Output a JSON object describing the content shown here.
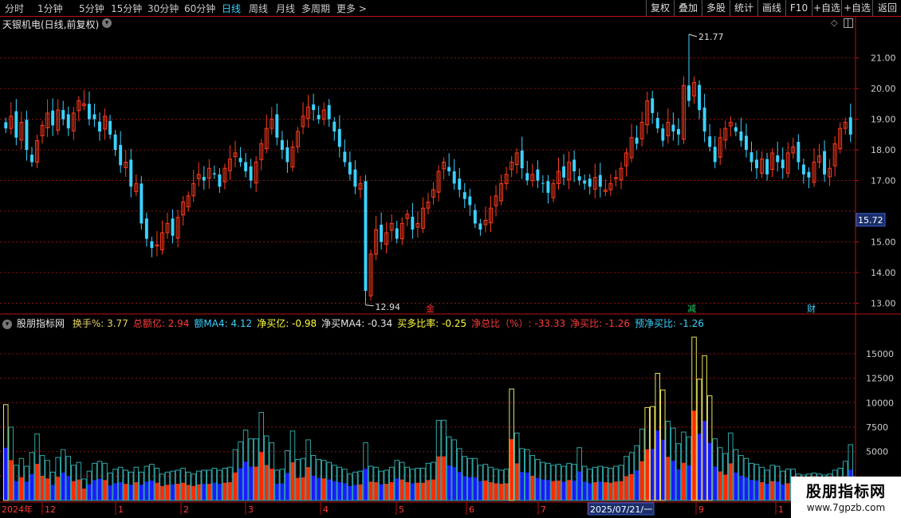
{
  "toolbar": {
    "periods": [
      {
        "label": "分时",
        "active": false
      },
      {
        "label": "1分钟",
        "active": false
      },
      {
        "label": "5分钟",
        "active": false
      },
      {
        "label": "15分钟",
        "active": false
      },
      {
        "label": "30分钟",
        "active": false
      },
      {
        "label": "60分钟",
        "active": false
      },
      {
        "label": "日线",
        "active": true
      },
      {
        "label": "周线",
        "active": false
      },
      {
        "label": "月线",
        "active": false
      },
      {
        "label": "多周期",
        "active": false
      },
      {
        "label": "更多 >",
        "active": false
      }
    ],
    "actions": [
      "复权",
      "叠加",
      "多股",
      "统计",
      "画线",
      "F10",
      "+自选",
      "返回"
    ],
    "periods_wide": [
      0,
      0,
      0,
      0,
      0,
      0,
      0,
      0,
      0,
      0,
      0
    ]
  },
  "price_panel": {
    "title": "天银机电(日线,前复权)",
    "y_ticks": [
      "21.00",
      "20.00",
      "19.00",
      "18.00",
      "17.00",
      "15.00",
      "14.00",
      "13.00"
    ],
    "current_price": "15.72",
    "high_label": "21.77",
    "low_label": "12.94",
    "markers": [
      {
        "text": "金",
        "color": "#ff3030"
      },
      {
        "text": "减",
        "color": "#22cc66"
      },
      {
        "text": "财",
        "color": "#3bd2ff"
      }
    ]
  },
  "indicator": {
    "name": "股朋指标网",
    "items": [
      {
        "label": "换手%: 3.77",
        "color": "#e8d26a"
      },
      {
        "label": "总额亿: 2.94",
        "color": "#ff3b3b"
      },
      {
        "label": "额MA4: 4.12",
        "color": "#3bd2ff"
      },
      {
        "label": "净买亿: -0.98",
        "color": "#ffff3b"
      },
      {
        "label": "净买MA4: -0.34",
        "color": "#e6e6e6"
      },
      {
        "label": "买多比率: -0.25",
        "color": "#ffff3b"
      },
      {
        "label": "净总比（%）: -33.33",
        "color": "#ff3b3b"
      },
      {
        "label": "净买比: -1.26",
        "color": "#ff3b3b"
      },
      {
        "label": "预净买比: -1.26",
        "color": "#3bd2ff"
      }
    ],
    "y_ticks": [
      "15000",
      "12500",
      "10000",
      "7500",
      "5000"
    ]
  },
  "date_axis": [
    "2024年",
    "12",
    "1",
    "2",
    "3",
    "4",
    "5",
    "6",
    "7",
    "2025/07/21/一",
    "9",
    "1"
  ],
  "watermark": {
    "title": "股朋指标网",
    "url": "www.7gpzb.com"
  },
  "colors": {
    "up": "#ff3b1e",
    "down": "#3bd2ff",
    "grid": "#8b1414",
    "vol_up": "#ff2a00",
    "vol_down": "#1a1aff",
    "ma_outline": "#2fa7a7",
    "peak_outline": "#e8e15a"
  },
  "chart_data": {
    "type": "candlestick",
    "y_range": [
      12.7,
      21.9
    ],
    "high": 21.77,
    "low": 12.94,
    "last": 15.72,
    "x_labels": [
      "2024年",
      "12",
      "1",
      "2",
      "3",
      "4",
      "5",
      "6",
      "7",
      "2025/07/21/一",
      "9",
      "1"
    ],
    "close": [
      18.7,
      19.1,
      18.4,
      18.9,
      18.0,
      17.6,
      18.3,
      18.8,
      19.2,
      18.8,
      19.3,
      19.0,
      18.7,
      19.2,
      19.6,
      19.5,
      19.0,
      19.0,
      18.6,
      19.1,
      18.5,
      18.0,
      17.5,
      17.6,
      16.8,
      16.9,
      15.6,
      15.1,
      14.8,
      14.9,
      15.3,
      15.6,
      15.2,
      15.8,
      16.3,
      16.5,
      16.9,
      17.2,
      17.0,
      17.4,
      17.2,
      16.8,
      17.4,
      17.7,
      17.9,
      17.6,
      17.3,
      17.0,
      17.6,
      18.2,
      18.7,
      19.0,
      18.4,
      18.0,
      17.6,
      18.1,
      18.6,
      19.1,
      19.4,
      19.3,
      19.0,
      19.3,
      19.0,
      18.6,
      18.1,
      17.6,
      17.2,
      16.8,
      16.9,
      13.4,
      14.6,
      15.4,
      15.0,
      15.3,
      15.6,
      15.1,
      15.6,
      15.9,
      15.4,
      15.6,
      16.1,
      16.3,
      16.7,
      17.3,
      17.6,
      17.3,
      16.9,
      16.7,
      16.4,
      16.2,
      15.6,
      15.4,
      15.7,
      16.1,
      16.5,
      16.9,
      17.2,
      17.6,
      17.9,
      17.4,
      17.0,
      17.2,
      17.0,
      16.9,
      16.6,
      16.9,
      17.3,
      17.1,
      17.6,
      17.3,
      17.0,
      16.9,
      16.8,
      17.1,
      16.8,
      16.7,
      16.9,
      17.1,
      17.4,
      17.9,
      18.4,
      18.2,
      18.9,
      19.6,
      19.2,
      18.7,
      18.3,
      18.9,
      18.6,
      18.5,
      20.1,
      19.6,
      20.2,
      19.3,
      18.6,
      18.1,
      17.6,
      18.4,
      18.7,
      18.9,
      18.6,
      18.3,
      18.0,
      17.6,
      17.4,
      17.7,
      17.2,
      17.9,
      17.6,
      17.4,
      17.9,
      18.1,
      17.6,
      17.2,
      17.1,
      17.6,
      17.8,
      17.2,
      17.4,
      18.2,
      18.7,
      18.9,
      18.5
    ],
    "volume": [
      9800,
      7500,
      3600,
      4300,
      3500,
      4900,
      6800,
      4600,
      4100,
      2900,
      4400,
      5200,
      4500,
      3600,
      3900,
      2200,
      3000,
      3800,
      4000,
      3800,
      2800,
      3200,
      3400,
      3100,
      2900,
      3400,
      2900,
      3500,
      3700,
      3300,
      2700,
      2900,
      3000,
      3100,
      3300,
      2900,
      2700,
      3000,
      3100,
      3100,
      3300,
      3100,
      3300,
      3400,
      5200,
      6000,
      7200,
      6300,
      6300,
      9000,
      6600,
      5900,
      3100,
      3200,
      5100,
      7100,
      4200,
      4300,
      6200,
      4600,
      4200,
      4100,
      3900,
      3600,
      3400,
      3200,
      2700,
      2900,
      3000,
      5900,
      3500,
      3400,
      3000,
      3100,
      3400,
      4100,
      3900,
      3400,
      3200,
      3300,
      3300,
      3800,
      3900,
      8200,
      8200,
      6500,
      6200,
      5300,
      4500,
      4300,
      4300,
      3600,
      3700,
      3400,
      3200,
      3100,
      3200,
      11400,
      6900,
      5300,
      5200,
      4600,
      4200,
      3900,
      3800,
      3600,
      3700,
      3500,
      3800,
      3700,
      5400,
      3500,
      3200,
      3400,
      3500,
      3400,
      3300,
      3500,
      3600,
      4500,
      4900,
      5600,
      7300,
      9500,
      9600,
      13000,
      11300,
      8100,
      7400,
      5800,
      7000,
      6500,
      16700,
      12400,
      14800,
      10700,
      6300,
      5400,
      4800,
      6900,
      5200,
      4600,
      4300,
      3800,
      3700,
      3400,
      3100,
      3600,
      3500,
      3000,
      3200,
      3200,
      2700,
      2600,
      2700,
      2800,
      2700,
      2600,
      2700,
      3100,
      3300,
      4000,
      5700,
      4200,
      3700
    ]
  }
}
